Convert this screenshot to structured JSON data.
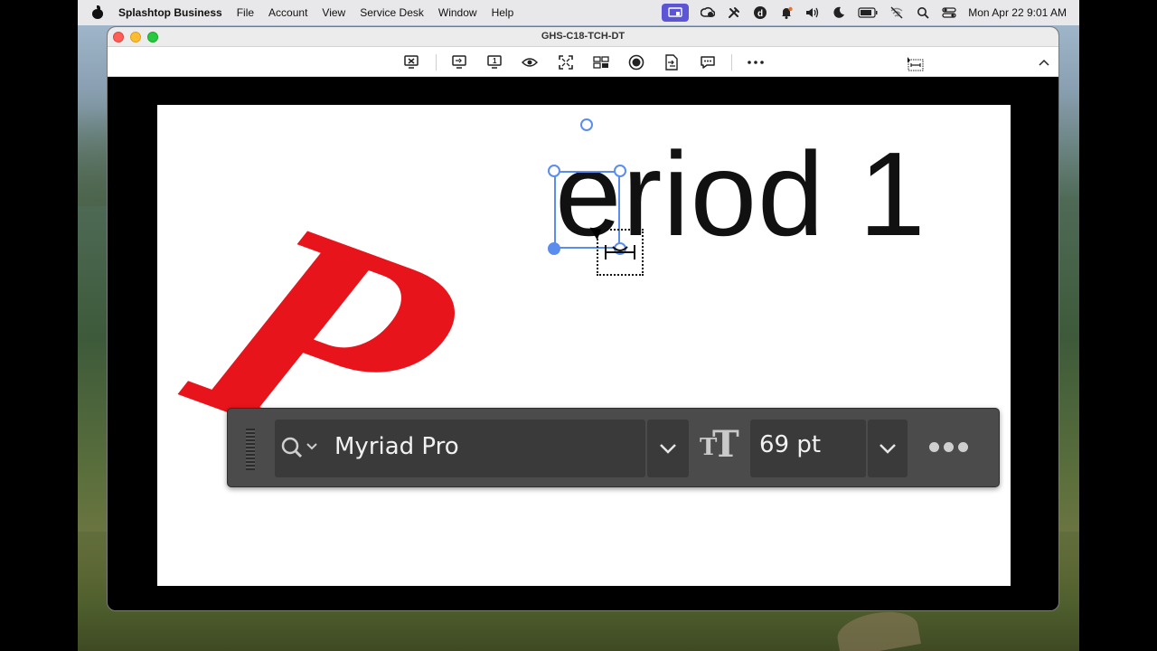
{
  "menubar": {
    "app_name": "Splashtop Business",
    "items": [
      "File",
      "Account",
      "View",
      "Service Desk",
      "Window",
      "Help"
    ],
    "clock": "Mon Apr 22  9:01 AM",
    "status_icons": [
      "splashtop-status-icon",
      "creative-cloud-icon",
      "tools-icon",
      "d-app-icon",
      "notification-bell-icon",
      "volume-icon",
      "do-not-disturb-moon-icon",
      "battery-icon",
      "wifi-off-icon",
      "search-icon",
      "control-center-icon"
    ]
  },
  "window": {
    "title": "GHS-C18-TCH-DT",
    "toolbar_icons": [
      "disconnect-icon",
      "switch-monitor-icon",
      "single-monitor-icon",
      "view-only-eye-icon",
      "fit-screen-icon",
      "multi-monitor-icon",
      "record-icon",
      "file-transfer-icon",
      "chat-icon",
      "more-icon",
      "resize-cursor-icon",
      "collapse-chevron-icon"
    ]
  },
  "remote": {
    "big_letter": "P",
    "big_letter_color": "#e8141c",
    "headline": "eriod 1",
    "font_bar": {
      "font_name": "Myriad Pro",
      "font_size": "69 pt"
    }
  },
  "colors": {
    "selection": "#5b8def",
    "menubar_accent": "#5c55d6"
  }
}
